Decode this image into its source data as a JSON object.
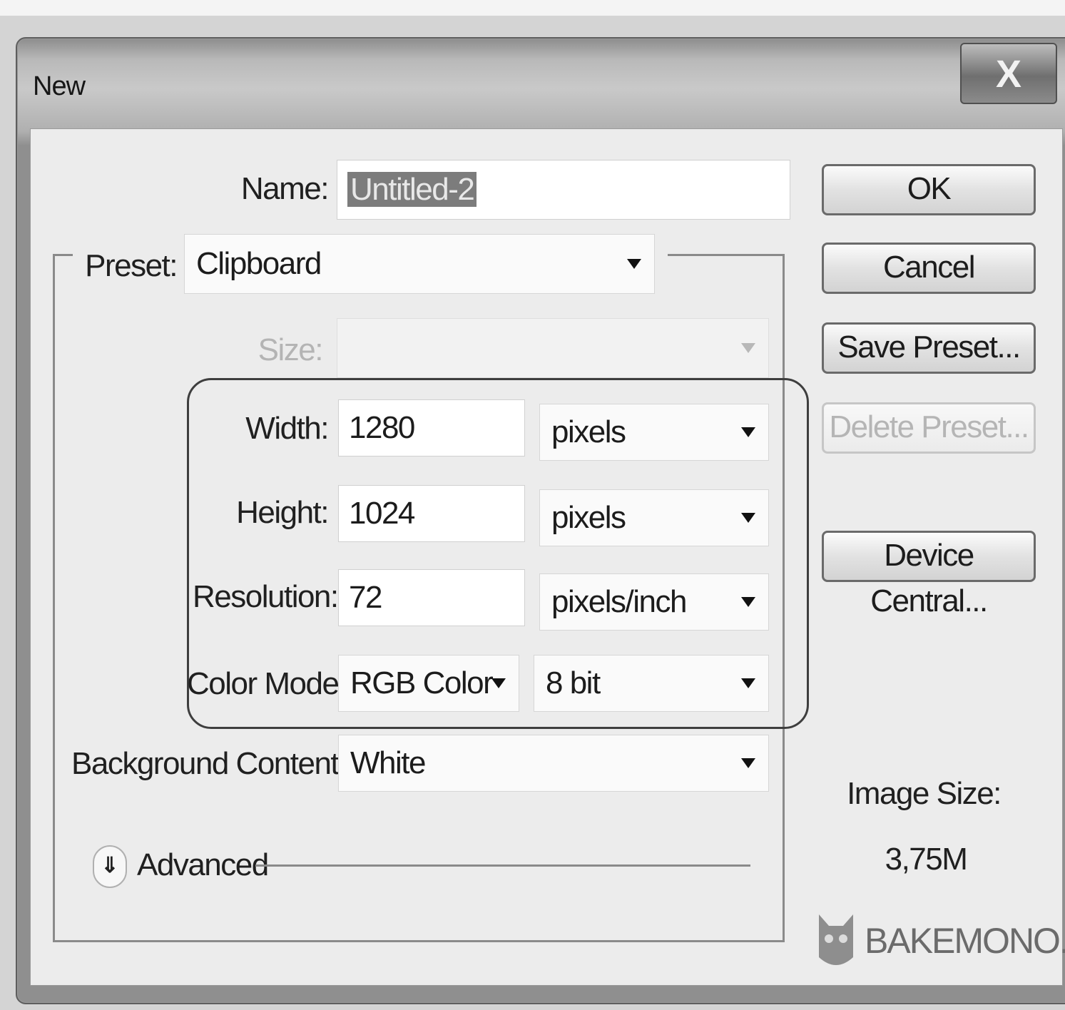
{
  "window": {
    "title": "New",
    "close_label": "X"
  },
  "form": {
    "name_label": "Name:",
    "name_value": "Untitled-2",
    "preset_label": "Preset:",
    "preset_value": "Clipboard",
    "size_label": "Size:",
    "size_value": "",
    "width_label": "Width:",
    "width_value": "1280",
    "width_unit": "pixels",
    "height_label": "Height:",
    "height_value": "1024",
    "height_unit": "pixels",
    "resolution_label": "Resolution:",
    "resolution_value": "72",
    "resolution_unit": "pixels/inch",
    "color_mode_label": "Color Mode:",
    "color_mode_value": "RGB Color",
    "bit_depth_value": "8 bit",
    "background_label": "Background Contents:",
    "background_value": "White",
    "advanced_label": "Advanced"
  },
  "buttons": {
    "ok": "OK",
    "cancel": "Cancel",
    "save_preset": "Save Preset...",
    "delete_preset": "Delete Preset...",
    "device_central": "Device Central..."
  },
  "image_size": {
    "label": "Image Size:",
    "value": "3,75M"
  },
  "watermark": "BAKEMONO.RU",
  "colors": {
    "selection": "#7c7c7c",
    "window_frame": "#8d8d8d",
    "client_bg": "#ececec"
  },
  "icons": {
    "close": "close-icon",
    "dropdown": "chevron-down-icon",
    "advanced": "double-chevron-down-icon",
    "watermark_logo": "cat-icon"
  }
}
